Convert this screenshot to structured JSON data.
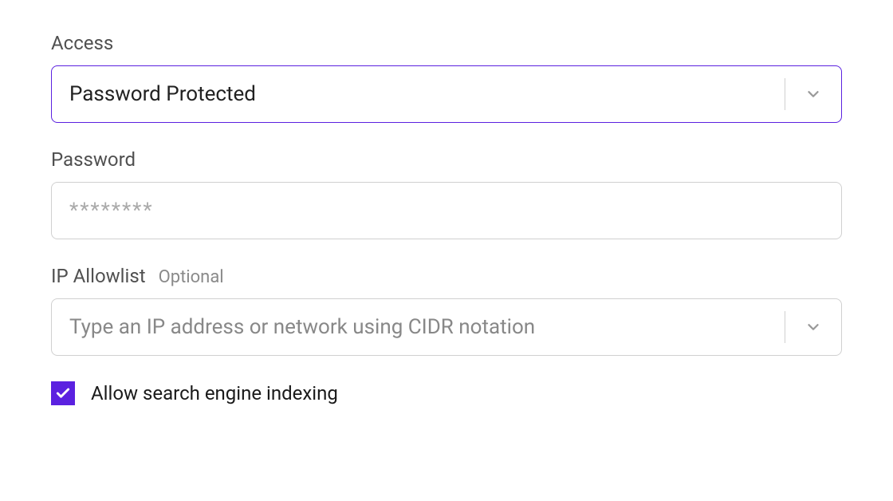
{
  "access": {
    "label": "Access",
    "value": "Password Protected"
  },
  "password": {
    "label": "Password",
    "placeholder": "********"
  },
  "ip_allowlist": {
    "label": "IP Allowlist",
    "optional": "Optional",
    "placeholder": "Type an IP address or network using CIDR notation"
  },
  "indexing": {
    "label": "Allow search engine indexing",
    "checked": true
  }
}
